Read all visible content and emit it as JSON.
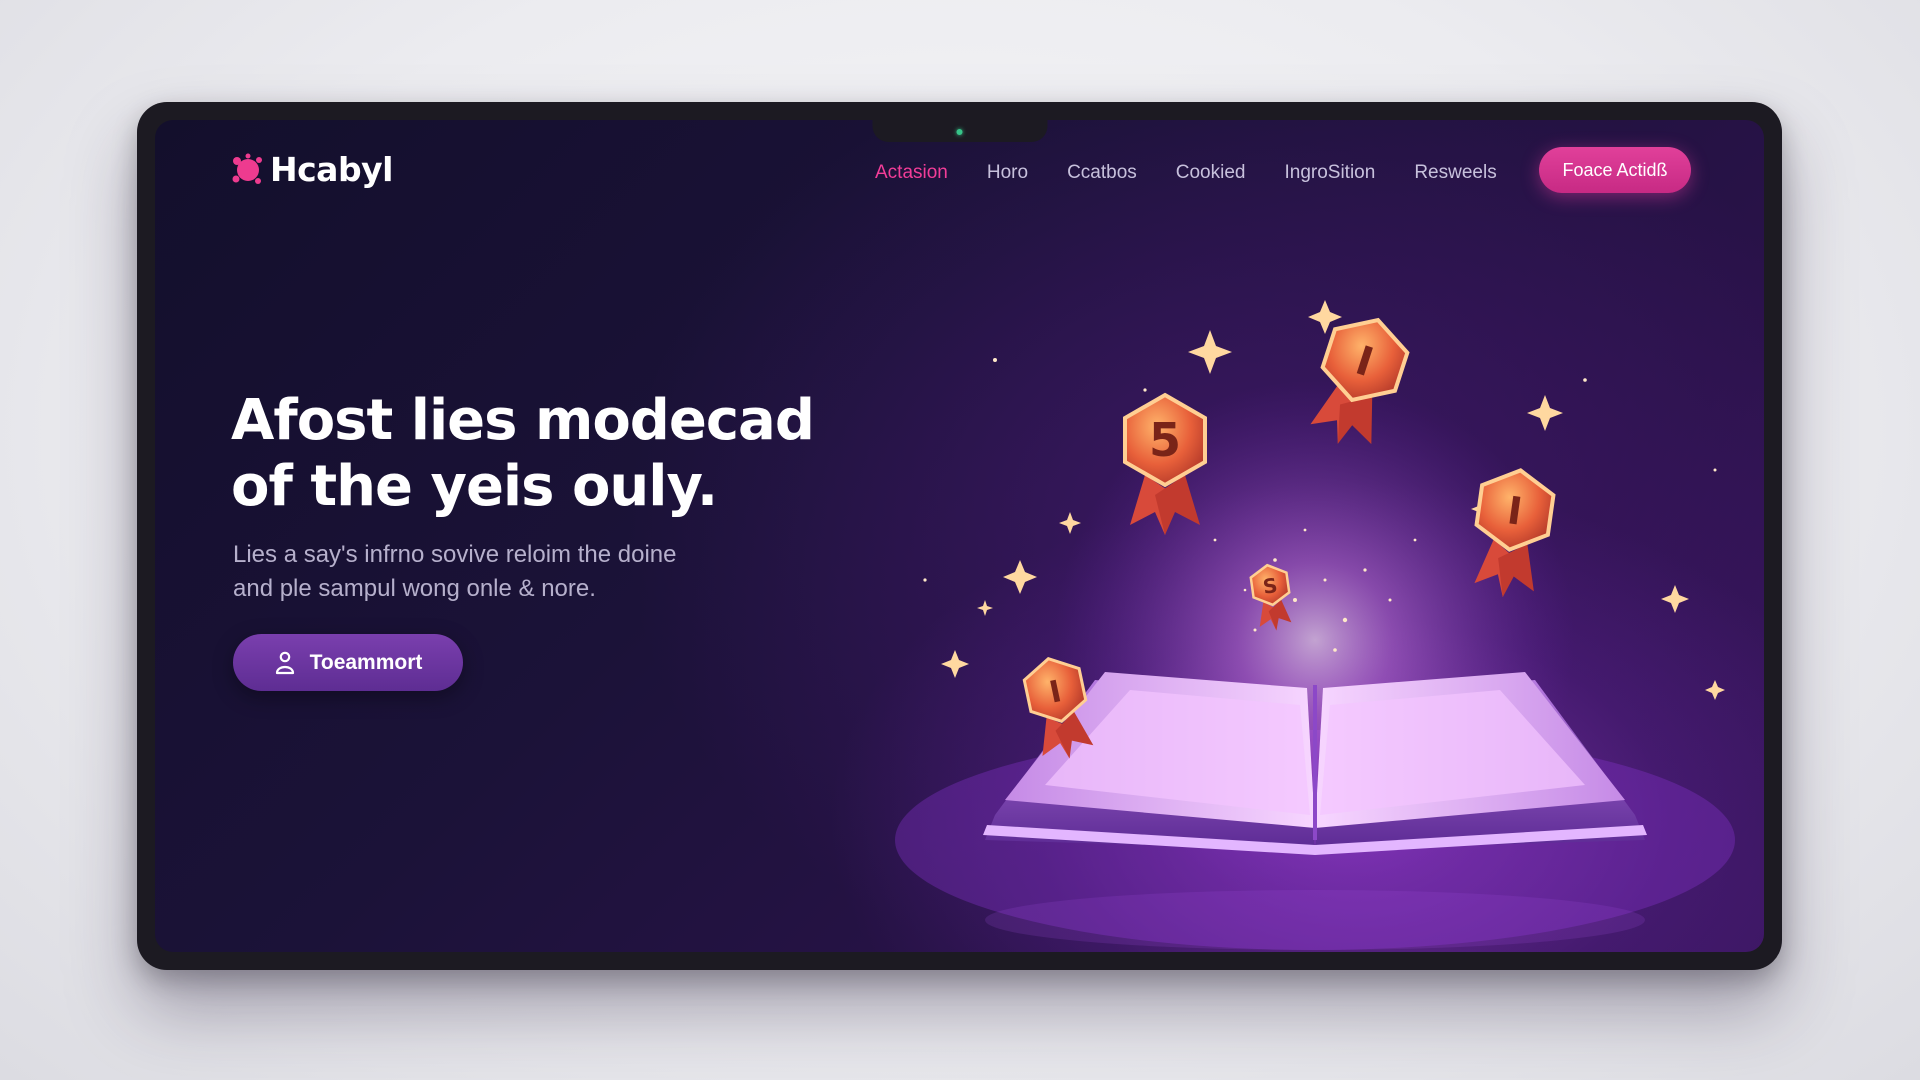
{
  "brand": {
    "name": "Hcabyl",
    "accent": "#f23d98"
  },
  "nav": {
    "items": [
      "Actasion",
      "Horo",
      "Ccatbos",
      "Cookied",
      "IngroSition",
      "Resweels"
    ],
    "active_index": 0,
    "cta_label": "Foace Actidß"
  },
  "hero": {
    "title_line1": "Afost lies modecad",
    "title_line2": "of the yeis ouly.",
    "subtitle_line1": "Lies a say's infrno sovive reloim the doine",
    "subtitle_line2": "and ple sampul wong onle & nore.",
    "button_label": "Toeammort",
    "button_icon": "person-icon"
  },
  "illustration": {
    "badges": [
      "5",
      "I",
      "I",
      "I",
      "S"
    ],
    "icons": [
      "open-book-icon",
      "medal-icon",
      "sparkle-icon"
    ]
  },
  "colors": {
    "background_dark": "#130f2c",
    "purple_glow": "#aa46dc",
    "cta_pink": "#d4358f",
    "badge_orange": "#e8603a"
  }
}
